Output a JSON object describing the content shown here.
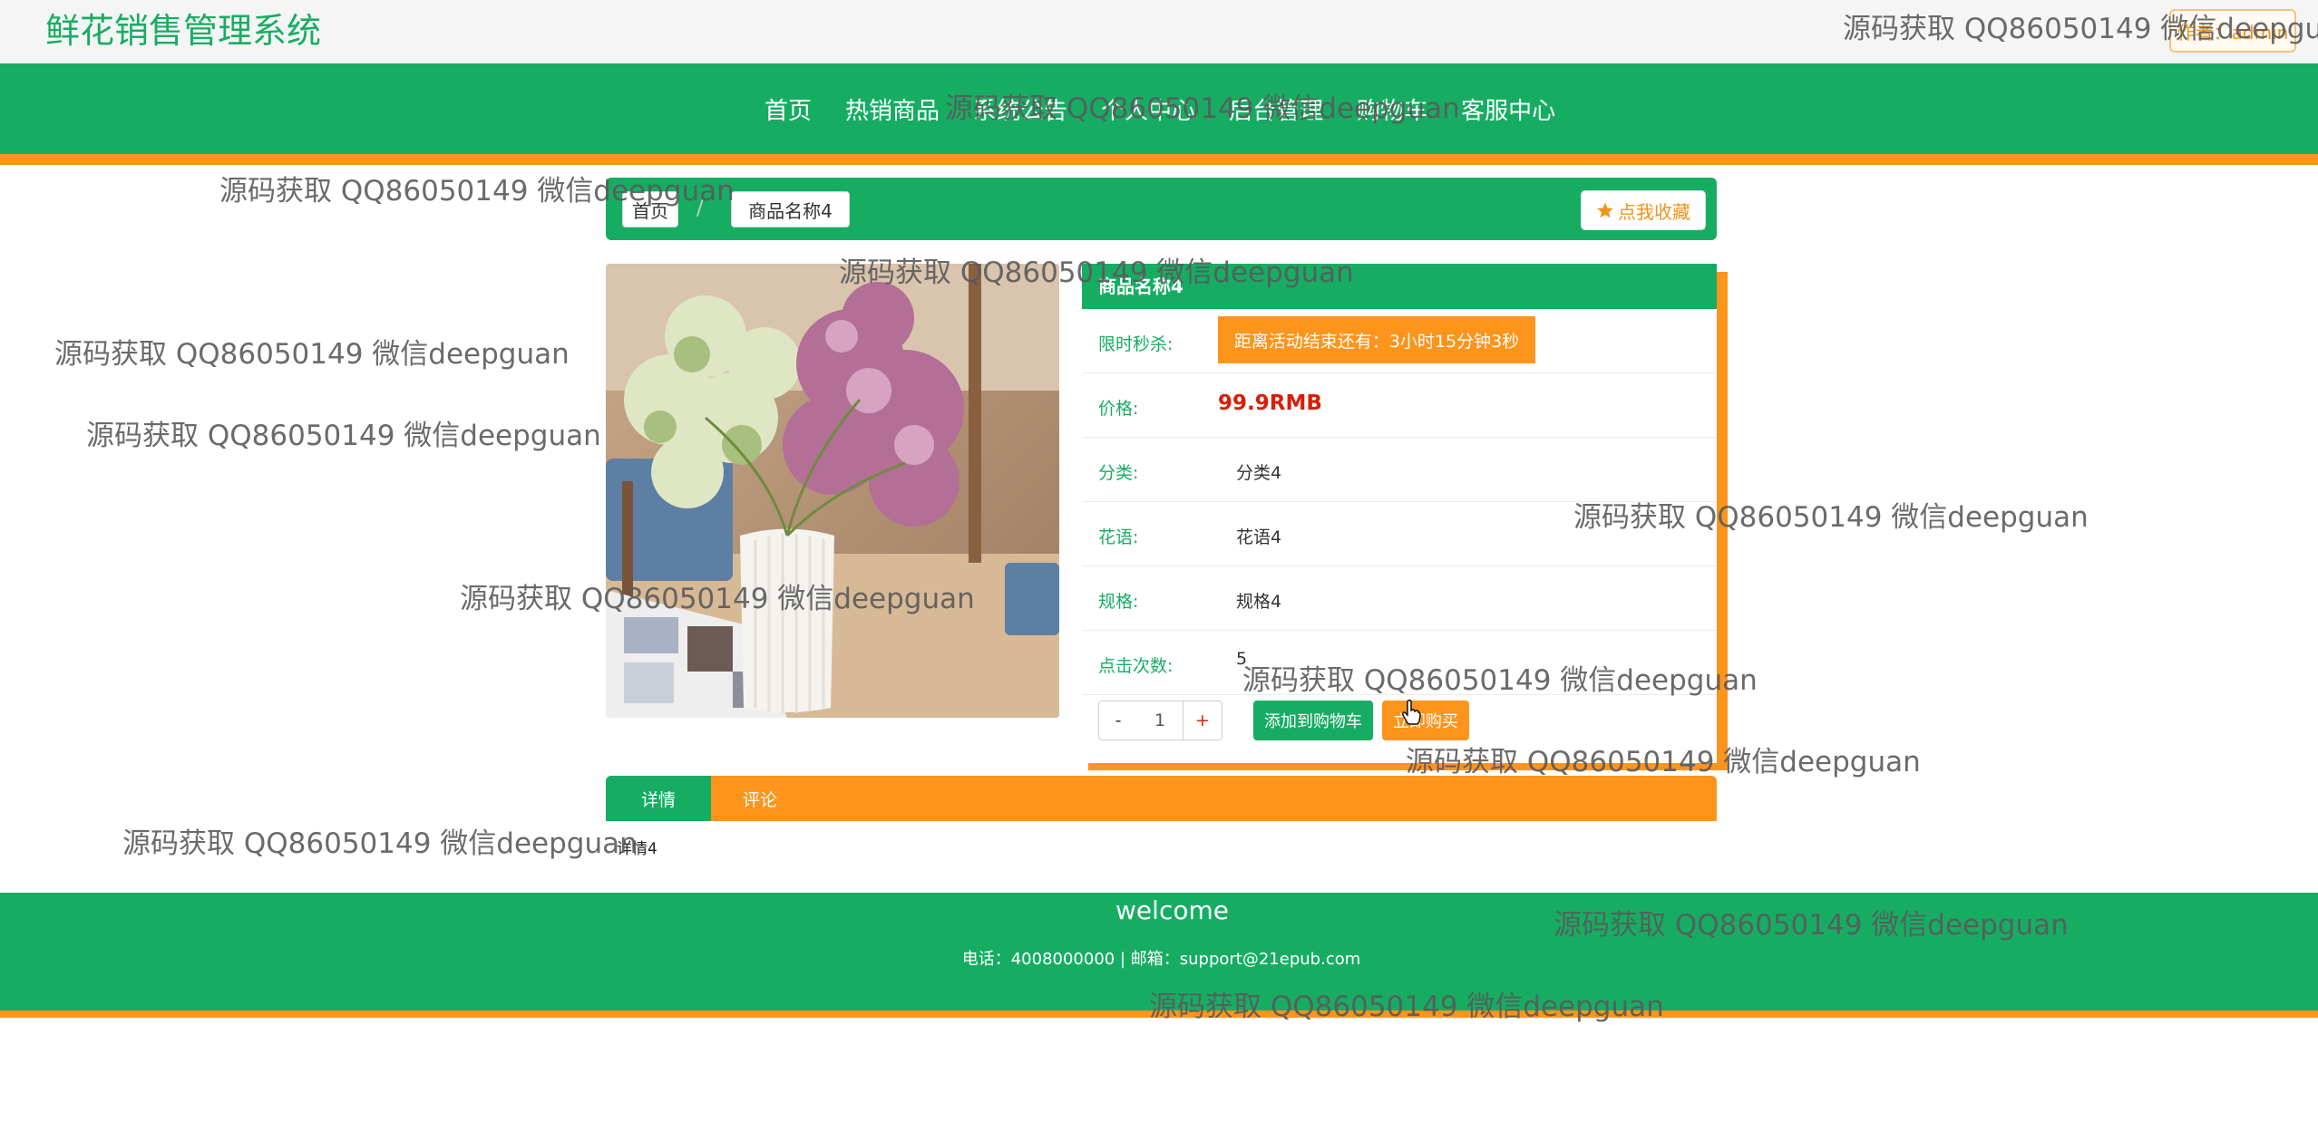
{
  "header": {
    "brand": "鲜花销售管理系统",
    "author_badge": "作者：admin"
  },
  "nav": {
    "items": [
      "首页",
      "热销商品",
      "系统公告",
      "个人中心",
      "后台管理",
      "购物车",
      "客服中心"
    ]
  },
  "breadcrumb": {
    "home": "首页",
    "separator": "/",
    "current": "商品名称4",
    "favorite_label": "点我收藏"
  },
  "product": {
    "image_alt": "商品名称4",
    "name": "商品名称4",
    "flash_label": "限时秒杀:",
    "flash_countdown": "距离活动结束还有：3小时15分钟3秒",
    "price_label": "价格:",
    "price": "99.9RMB",
    "category_label": "分类:",
    "category": "分类4",
    "flower_language_label": "花语:",
    "flower_language": "花语4",
    "spec_label": "规格:",
    "spec": "规格4",
    "clicks_label": "点击次数:",
    "clicks": "5",
    "qty_minus": "-",
    "quantity": "1",
    "qty_plus": "+",
    "add_to_cart": "添加到购物车",
    "buy_now": "立即购买"
  },
  "tabs": [
    "详情",
    "评论"
  ],
  "detail_text": "详情4",
  "footer": {
    "welcome": "welcome",
    "contact": "电话：4008000000 | 邮箱：support@21epub.com"
  },
  "watermark": "源码获取 QQ86050149 微信deepguan",
  "colors": {
    "primary_green": "#16ad63",
    "accent_orange": "#fd941c",
    "price_red": "#d81e06"
  }
}
